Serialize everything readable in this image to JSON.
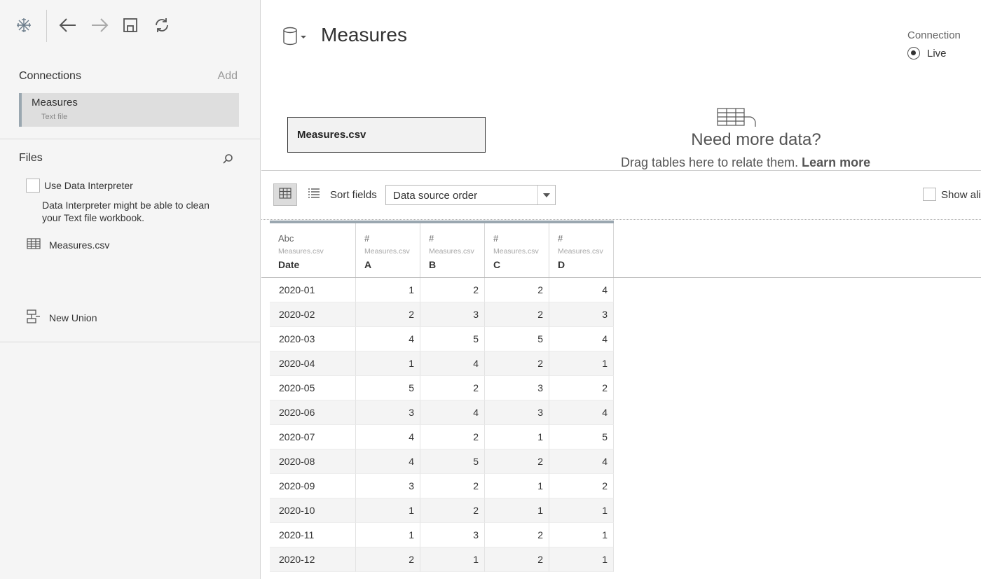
{
  "toolbar": {
    "icons": [
      "tableau-logo-icon",
      "back-arrow-icon",
      "forward-arrow-icon",
      "save-icon",
      "refresh-icon"
    ]
  },
  "connections": {
    "heading": "Connections",
    "add_label": "Add",
    "items": [
      {
        "name": "Measures",
        "type": "Text file"
      }
    ]
  },
  "files": {
    "heading": "Files",
    "interpreter_label": "Use Data Interpreter",
    "interpreter_checked": false,
    "interpreter_description": "Data Interpreter might be able to clean your Text file workbook.",
    "file_name": "Measures.csv",
    "new_union_label": "New Union"
  },
  "main": {
    "datasource_title": "Measures",
    "connection_label": "Connection",
    "connection_mode": "Live",
    "table_pill": "Measures.csv",
    "need_more_title": "Need more data?",
    "need_more_text": "Drag tables here to relate them.",
    "learn_more": "Learn more"
  },
  "grid_toolbar": {
    "sort_label": "Sort fields",
    "sort_value": "Data source order",
    "show_all_label": "Show ali"
  },
  "table": {
    "columns": [
      {
        "type": "Abc",
        "source": "Measures.csv",
        "name": "Date"
      },
      {
        "type": "#",
        "source": "Measures.csv",
        "name": "A"
      },
      {
        "type": "#",
        "source": "Measures.csv",
        "name": "B"
      },
      {
        "type": "#",
        "source": "Measures.csv",
        "name": "C"
      },
      {
        "type": "#",
        "source": "Measures.csv",
        "name": "D"
      }
    ],
    "rows": [
      [
        "2020-01",
        "1",
        "2",
        "2",
        "4"
      ],
      [
        "2020-02",
        "2",
        "3",
        "2",
        "3"
      ],
      [
        "2020-03",
        "4",
        "5",
        "5",
        "4"
      ],
      [
        "2020-04",
        "1",
        "4",
        "2",
        "1"
      ],
      [
        "2020-05",
        "5",
        "2",
        "3",
        "2"
      ],
      [
        "2020-06",
        "3",
        "4",
        "3",
        "4"
      ],
      [
        "2020-07",
        "4",
        "2",
        "1",
        "5"
      ],
      [
        "2020-08",
        "4",
        "5",
        "2",
        "4"
      ],
      [
        "2020-09",
        "3",
        "2",
        "1",
        "2"
      ],
      [
        "2020-10",
        "1",
        "2",
        "1",
        "1"
      ],
      [
        "2020-11",
        "1",
        "3",
        "2",
        "1"
      ],
      [
        "2020-12",
        "2",
        "1",
        "2",
        "1"
      ]
    ]
  }
}
